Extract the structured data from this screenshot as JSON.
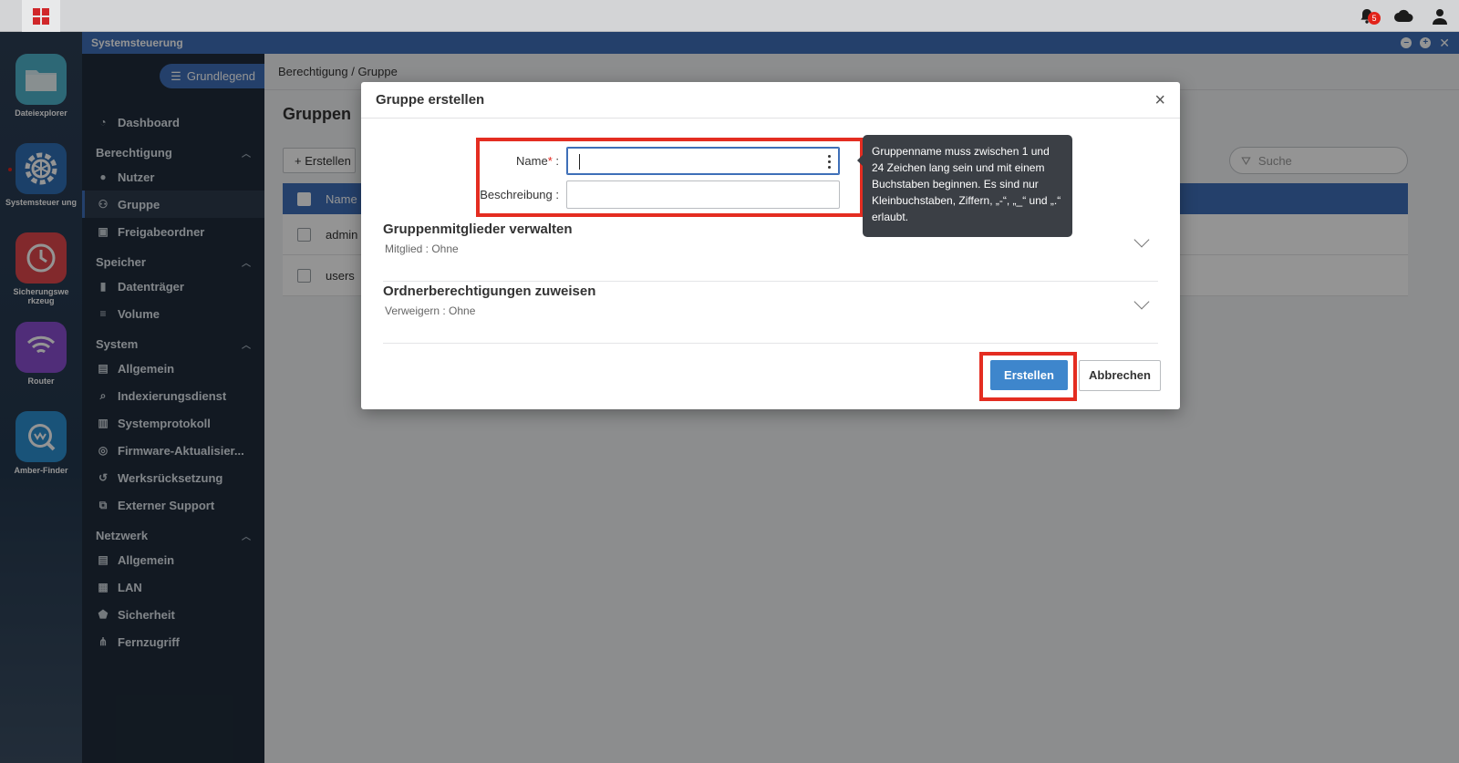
{
  "topbar": {
    "notification_count": "5",
    "icons": [
      "app-launcher-icon",
      "bell-icon",
      "cloud-icon",
      "user-icon"
    ]
  },
  "dock": [
    {
      "label": "Dateiexplorer",
      "icon": "folder-icon"
    },
    {
      "label": "Systemsteuer ung",
      "icon": "gear-icon"
    },
    {
      "label": "Sicherungswe rkzeug",
      "icon": "clock-backup-icon"
    },
    {
      "label": "Router",
      "icon": "wifi-icon"
    },
    {
      "label": "Amber-Finder",
      "icon": "search-icon"
    }
  ],
  "window": {
    "title": "Systemsteuerung"
  },
  "sidebar": {
    "mode_label": "Grundlegend",
    "dashboard": "Dashboard",
    "sections": [
      {
        "title": "Berechtigung",
        "items": [
          "Nutzer",
          "Gruppe",
          "Freigabeordner"
        ]
      },
      {
        "title": "Speicher",
        "items": [
          "Datenträger",
          "Volume"
        ]
      },
      {
        "title": "System",
        "items": [
          "Allgemein",
          "Indexierungsdienst",
          "Systemprotokoll",
          "Firmware-Aktualisier...",
          "Werksrücksetzung",
          "Externer Support"
        ]
      },
      {
        "title": "Netzwerk",
        "items": [
          "Allgemein",
          "LAN",
          "Sicherheit",
          "Fernzugriff"
        ]
      }
    ]
  },
  "main": {
    "breadcrumb": "Berechtigung / Gruppe",
    "page_title": "Gruppen",
    "create_label": "Erstellen",
    "search_placeholder": "Suche",
    "table": {
      "column_name": "Name",
      "rows": [
        "admin",
        "users"
      ]
    }
  },
  "dialog": {
    "title": "Gruppe erstellen",
    "name_label": "Name",
    "required_mark": "*",
    "colon": ":",
    "name_value": "",
    "description_label": "Beschreibung :",
    "description_value": "",
    "tooltip": "Gruppenname muss zwischen 1 und 24 Zeichen lang sein und mit einem Buchstaben beginnen. Es sind nur Kleinbuchstaben, Ziffern, „-“, „_“ und „.“ erlaubt.",
    "members_title": "Gruppenmitglieder verwalten",
    "members_sub": "Mitglied : Ohne",
    "folder_title": "Ordnerberechtigungen zuweisen",
    "folder_sub": "Verweigern : Ohne",
    "submit_label": "Erstellen",
    "cancel_label": "Abbrechen"
  },
  "colors": {
    "accent": "#3e6fb8",
    "highlight": "#e42d21",
    "badge": "#e2231a"
  }
}
